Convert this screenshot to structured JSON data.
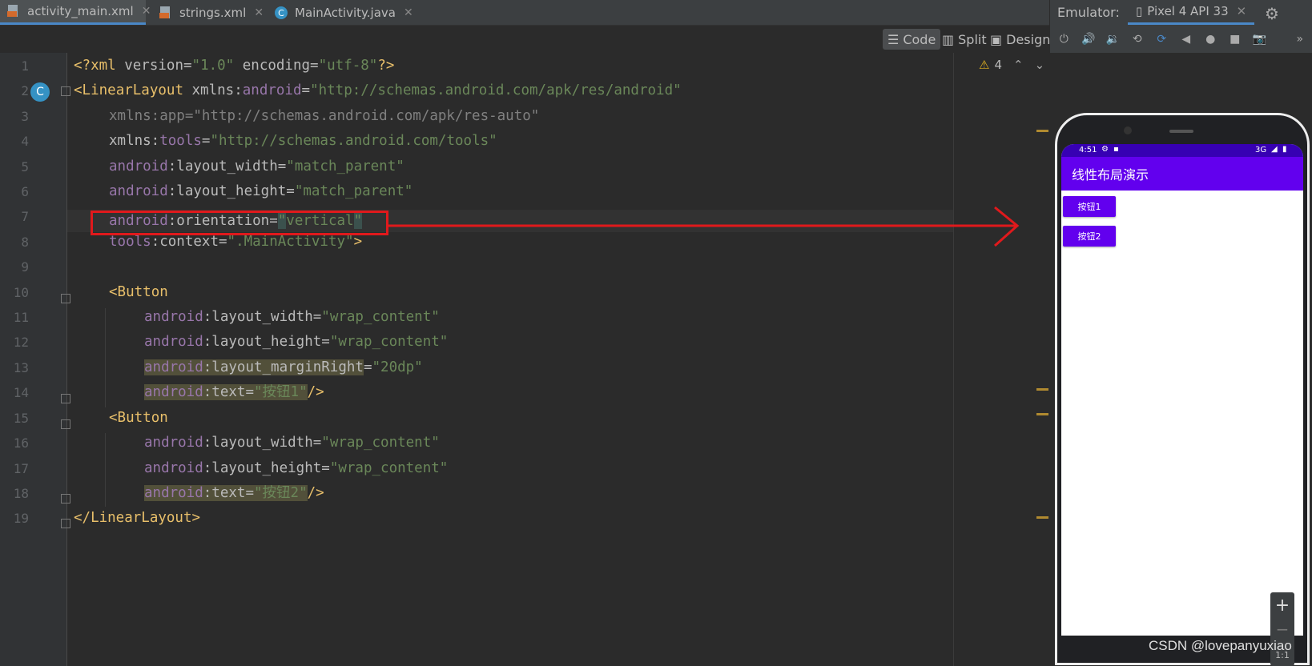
{
  "tabs": [
    {
      "label": "activity_main.xml",
      "icon": "xml-file-icon",
      "active": true
    },
    {
      "label": "strings.xml",
      "icon": "xml-file-icon",
      "active": false
    },
    {
      "label": "MainActivity.java",
      "icon": "java-class-icon",
      "active": false
    }
  ],
  "view_modes": {
    "code": "Code",
    "split": "Split",
    "design": "Design"
  },
  "warnings": {
    "count": "4"
  },
  "gutter_class_badge": "C",
  "line_numbers": [
    "1",
    "2",
    "3",
    "4",
    "5",
    "6",
    "7",
    "8",
    "9",
    "10",
    "11",
    "12",
    "13",
    "14",
    "15",
    "16",
    "17",
    "18",
    "19"
  ],
  "code": {
    "l1": {
      "open": "<?",
      "tag": "xml",
      "a1": " version",
      "eq1": "=",
      "v1": "\"1.0\"",
      "a2": " encoding",
      "eq2": "=",
      "v2": "\"utf-8\"",
      "close": "?>"
    },
    "l2": {
      "open": "<",
      "tag": "LinearLayout",
      "a": " xmlns:",
      "ns": "android",
      "eq": "=",
      "v": "\"http://schemas.android.com/apk/res/android\""
    },
    "l3": {
      "text": "xmlns:app=\"http://schemas.android.com/apk/res-auto\""
    },
    "l4": {
      "a": "xmlns:",
      "ns": "tools",
      "eq": "=",
      "v": "\"http://schemas.android.com/tools\""
    },
    "l5": {
      "ns": "android",
      "a": ":layout_width",
      "eq": "=",
      "v": "\"match_parent\""
    },
    "l6": {
      "ns": "android",
      "a": ":layout_height",
      "eq": "=",
      "v": "\"match_parent\""
    },
    "l7": {
      "ns": "android",
      "a": ":orientation",
      "eq": "=",
      "q1": "\"",
      "v": "vertical",
      "q2": "\""
    },
    "l8": {
      "ns": "tools",
      "a": ":context",
      "eq": "=",
      "v": "\".MainActivity\"",
      "close": ">"
    },
    "l10": {
      "open": "<",
      "tag": "Button"
    },
    "l11": {
      "ns": "android",
      "a": ":layout_width",
      "eq": "=",
      "v": "\"wrap_content\""
    },
    "l12": {
      "ns": "android",
      "a": ":layout_height",
      "eq": "=",
      "v": "\"wrap_content\""
    },
    "l13": {
      "ns": "android",
      "a": ":layout_marginRight",
      "eq": "=",
      "v": "\"20dp\""
    },
    "l14": {
      "ns": "android",
      "a": ":text",
      "eq": "=",
      "v": "\"按钮1\"",
      "close": "/>"
    },
    "l15": {
      "open": "<",
      "tag": "Button"
    },
    "l16": {
      "ns": "android",
      "a": ":layout_width",
      "eq": "=",
      "v": "\"wrap_content\""
    },
    "l17": {
      "ns": "android",
      "a": ":layout_height",
      "eq": "=",
      "v": "\"wrap_content\""
    },
    "l18": {
      "ns": "android",
      "a": ":text",
      "eq": "=",
      "v": "\"按钮2\"",
      "close": "/>"
    },
    "l19": {
      "open": "</",
      "tag": "LinearLayout",
      "close": ">"
    }
  },
  "emulator": {
    "title": "Emulator:",
    "device": "Pixel 4 API 33",
    "status_time": "4:51",
    "status_network": "3G",
    "app_title": "线性布局演示",
    "buttons": [
      "按钮1",
      "按钮2"
    ]
  },
  "zoom": {
    "plus": "+",
    "minus": "−",
    "ratio": "1:1"
  },
  "watermark": "CSDN @lovepanyuxiao",
  "colors": {
    "annotation_red": "#e0191c",
    "app_bar": "#6200ee",
    "status_bar": "#3700b3"
  }
}
